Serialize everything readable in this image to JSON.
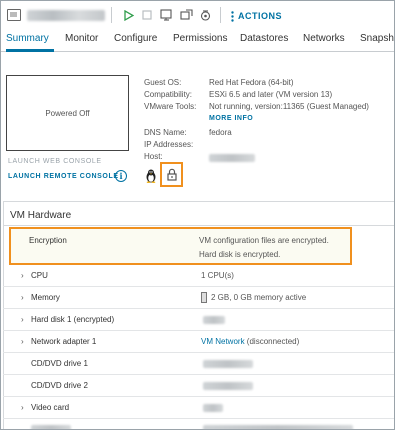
{
  "toolbar": {
    "actions_label": "ACTIONS",
    "icons": [
      "vm-icon",
      "power-on-icon",
      "power-off-icon",
      "suspend-icon",
      "migrate-icon",
      "snapshot-icon",
      "more-vertical-icon"
    ]
  },
  "tabs": [
    {
      "label": "Summary",
      "active": true
    },
    {
      "label": "Monitor",
      "active": false
    },
    {
      "label": "Configure",
      "active": false
    },
    {
      "label": "Permissions",
      "active": false
    },
    {
      "label": "Datastores",
      "active": false
    },
    {
      "label": "Networks",
      "active": false
    },
    {
      "label": "Snapsho",
      "active": false
    }
  ],
  "console": {
    "state": "Powered Off",
    "launch_web": "LAUNCH WEB CONSOLE",
    "launch_remote": "LAUNCH REMOTE CONSOLE",
    "info_glyph": "i"
  },
  "summary": {
    "guest_os_label": "Guest OS:",
    "guest_os_value": "Red Hat Fedora (64-bit)",
    "compatibility_label": "Compatibility:",
    "compatibility_value": "ESXi 6.5 and later (VM version 13)",
    "vmware_tools_label": "VMware Tools:",
    "vmware_tools_value": "Not running, version:11365 (Guest Managed)",
    "more_info": "MORE INFO",
    "dns_label": "DNS Name:",
    "dns_value": "fedora",
    "ip_label": "IP Addresses:",
    "host_label": "Host:"
  },
  "hardware": {
    "title": "VM Hardware",
    "encryption_label": "Encryption",
    "encryption_line1": "VM configuration files are encrypted.",
    "encryption_line2": "Hard disk is encrypted.",
    "rows": [
      {
        "label": "CPU",
        "value": "1 CPU(s)",
        "expandable": true
      },
      {
        "label": "Memory",
        "value": "2 GB, 0 GB memory active",
        "expandable": true
      },
      {
        "label": "Hard disk 1 (encrypted)",
        "value": "",
        "expandable": true
      },
      {
        "label": "Network adapter 1",
        "value_link": "VM Network",
        "value": "(disconnected)",
        "expandable": true
      },
      {
        "label": "CD/DVD drive 1",
        "value": "",
        "expandable": false
      },
      {
        "label": "CD/DVD drive 2",
        "value": "",
        "expandable": false
      },
      {
        "label": "Video card",
        "value": "",
        "expandable": true
      }
    ]
  },
  "colors": {
    "accent": "#0072a3",
    "highlight": "#f0901e",
    "text": "#333333",
    "muted": "#9aa3aa"
  }
}
